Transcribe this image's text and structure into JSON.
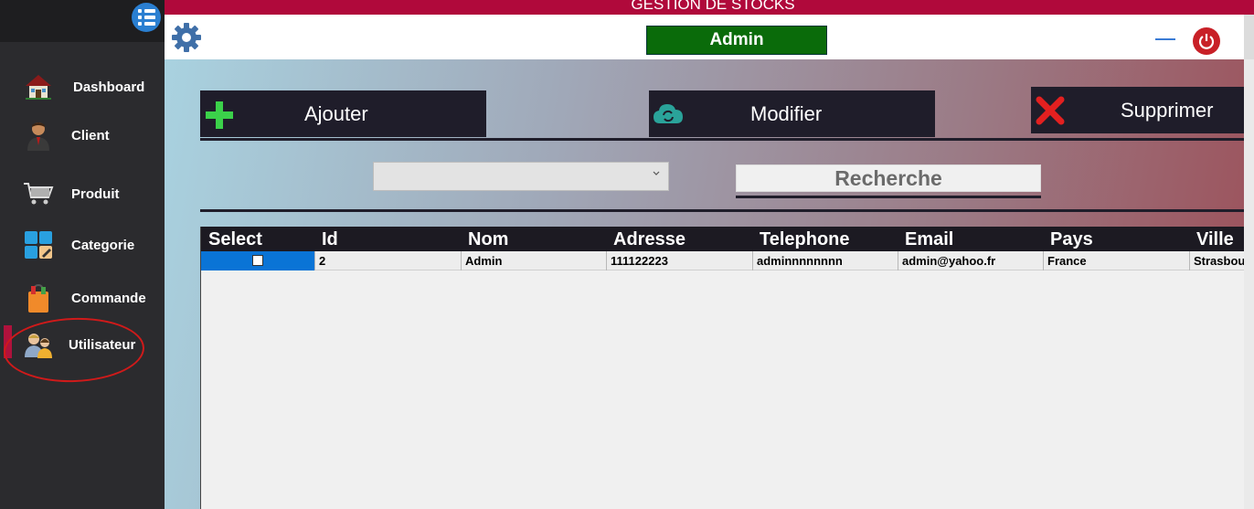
{
  "app": {
    "title": "GESTION DE STOCKS",
    "user": "Admin",
    "colors": {
      "title_bar": "#b0093b",
      "user_badge": "#0a6b0a",
      "sidebar": "#2b2b2e",
      "active_marker": "#b0123c"
    }
  },
  "sidebar": {
    "toggle_icon": "list-menu-icon",
    "items": [
      {
        "label": "Dashboard",
        "icon": "house-icon"
      },
      {
        "label": "Client",
        "icon": "businessman-icon"
      },
      {
        "label": "Produit",
        "icon": "shopping-cart-icon"
      },
      {
        "label": "Categorie",
        "icon": "tiles-icon"
      },
      {
        "label": "Commande",
        "icon": "shopping-bag-icon"
      },
      {
        "label": "Utilisateur",
        "icon": "users-icon"
      }
    ],
    "active": "Utilisateur"
  },
  "header": {
    "settings_icon": "gear-icon",
    "minimize_icon": "minimize-icon",
    "power_icon": "power-icon"
  },
  "toolbar": {
    "add_label": "Ajouter",
    "edit_label": "Modifier",
    "delete_label": "Supprimer"
  },
  "filter": {
    "select_value": "",
    "search_label": "Recherche"
  },
  "table": {
    "columns": [
      "Select",
      "Id",
      "Nom",
      "Adresse",
      "Telephone",
      "Email",
      "Pays",
      "Ville"
    ],
    "rows": [
      {
        "selected": false,
        "id": "2",
        "nom": "Admin",
        "adresse": "111122223",
        "telephone": "adminnnnnnnn",
        "email": "admin@yahoo.fr",
        "pays": "France",
        "ville": "Strasbourg"
      }
    ]
  }
}
